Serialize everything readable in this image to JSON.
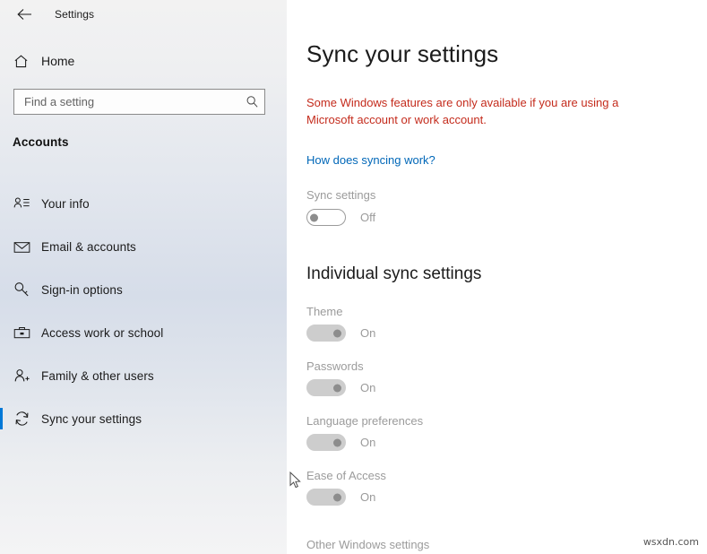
{
  "window": {
    "title": "Settings",
    "back_icon": "back-arrow-icon",
    "controls": {
      "minimize": "minimize-icon",
      "maximize": "maximize-icon",
      "close": "close-icon"
    }
  },
  "sidebar": {
    "home_label": "Home",
    "home_icon": "home-icon",
    "search": {
      "placeholder": "Find a setting",
      "value": "",
      "icon": "search-icon"
    },
    "section_title": "Accounts",
    "items": [
      {
        "label": "Your info",
        "icon": "user-info-icon",
        "selected": false
      },
      {
        "label": "Email & accounts",
        "icon": "envelope-icon",
        "selected": false
      },
      {
        "label": "Sign-in options",
        "icon": "key-icon",
        "selected": false
      },
      {
        "label": "Access work or school",
        "icon": "briefcase-icon",
        "selected": false
      },
      {
        "label": "Family & other users",
        "icon": "add-user-icon",
        "selected": false
      },
      {
        "label": "Sync your settings",
        "icon": "sync-icon",
        "selected": true
      }
    ]
  },
  "main": {
    "page_title": "Sync your settings",
    "warning_text": "Some Windows features are only available if you are using a Microsoft account or work account.",
    "link_text": "How does syncing work?",
    "sync_settings": {
      "label": "Sync settings",
      "state": "Off",
      "on": false
    },
    "individual_heading": "Individual sync settings",
    "individual_items": [
      {
        "label": "Theme",
        "state": "On",
        "on": true
      },
      {
        "label": "Passwords",
        "state": "On",
        "on": true
      },
      {
        "label": "Language preferences",
        "state": "On",
        "on": true
      },
      {
        "label": "Ease of Access",
        "state": "On",
        "on": true
      }
    ],
    "other_label": "Other Windows settings"
  },
  "watermark": "wsxdn.com",
  "colors": {
    "accent": "#0078d7",
    "link": "#0067b8",
    "warning": "#c42b1c",
    "disabled_text": "#9b9b9b"
  }
}
